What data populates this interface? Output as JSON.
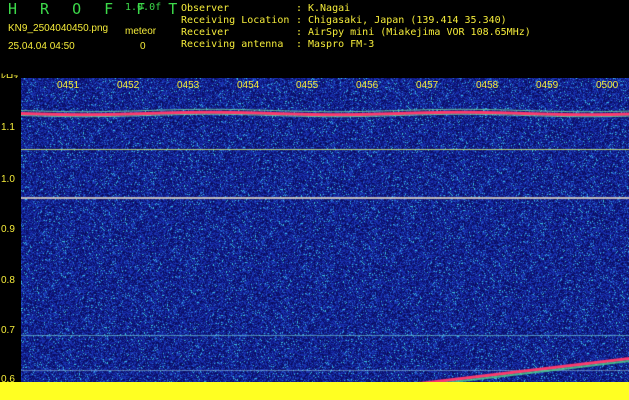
{
  "header": {
    "app_title": "H R O F F T",
    "version": "1.0.0f",
    "filename": "KN9_2504040450.png",
    "meteor_label": "meteor",
    "meteor_count": "0",
    "datetime": "25.04.04 04:50"
  },
  "info": [
    {
      "label": "Observer",
      "value": "K.Nagai"
    },
    {
      "label": "Receiving Location",
      "value": "Chigasaki, Japan (139.414 35.340)"
    },
    {
      "label": "Receiver",
      "value": "AirSpy mini (Miakejima VOR 108.65MHz)"
    },
    {
      "label": "Receiving antenna",
      "value": "Maspro FM-3"
    }
  ],
  "separator": ":",
  "axis": {
    "y_unit": "kHz",
    "y_ticks": [
      "1.1",
      "1.0",
      "0.9",
      "0.8",
      "0.7",
      "0.6"
    ],
    "x_ticks": [
      "0451",
      "0452",
      "0453",
      "0454",
      "0455",
      "0456",
      "0457",
      "0458",
      "0459",
      "0500"
    ]
  },
  "colors": {
    "background": "#1a2a9a",
    "text": "#f5ec3a",
    "title": "#3cd94a",
    "carrier": "#ff3a6e",
    "band": "#ffff22"
  }
}
